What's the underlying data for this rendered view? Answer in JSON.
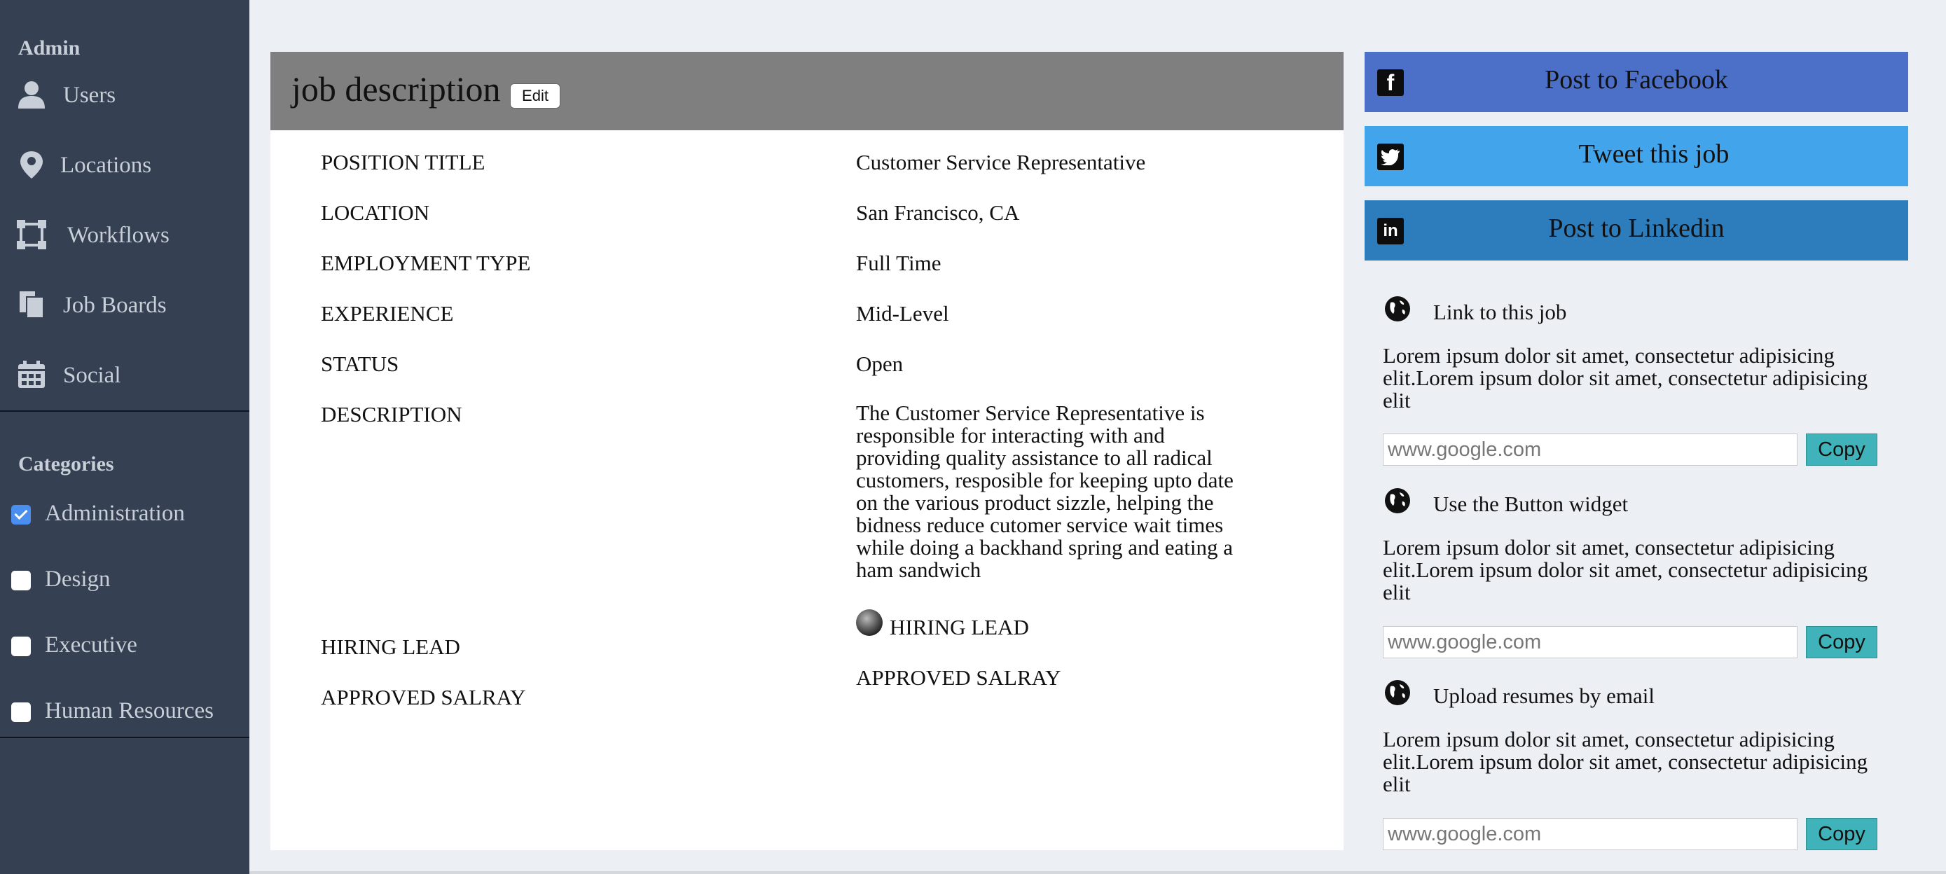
{
  "sidebar": {
    "admin_heading": "Admin",
    "items": [
      {
        "label": "Users",
        "icon": "user-icon"
      },
      {
        "label": "Locations",
        "icon": "map-pin-icon"
      },
      {
        "label": "Workflows",
        "icon": "workflow-icon"
      },
      {
        "label": "Job Boards",
        "icon": "clipboard-icon"
      },
      {
        "label": "Social",
        "icon": "calendar-icon"
      }
    ],
    "categories_heading": "Categories",
    "categories": [
      {
        "label": "Administration",
        "checked": true
      },
      {
        "label": "Design",
        "checked": false
      },
      {
        "label": "Executive",
        "checked": false
      },
      {
        "label": "Human Resources",
        "checked": false
      }
    ]
  },
  "job": {
    "title": "job description",
    "edit_label": "Edit",
    "fields": [
      {
        "label": "POSITION TITLE",
        "value": "Customer Service Representative"
      },
      {
        "label": "LOCATION",
        "value": "San Francisco, CA"
      },
      {
        "label": "EMPLOYMENT TYPE",
        "value": "Full Time"
      },
      {
        "label": "EXPERIENCE",
        "value": "Mid-Level"
      },
      {
        "label": "STATUS",
        "value": "Open"
      },
      {
        "label": "DESCRIPTION",
        "value": "The Customer Service Representative is responsible for interacting with and providing quality assistance to all radical customers, resposible for keeping upto date on the various product sizzle, helping the bidness reduce cutomer service wait times while doing a backhand spring and eating a ham sandwich"
      },
      {
        "label": "HIRING LEAD",
        "value": "HIRING LEAD"
      },
      {
        "label": "APPROVED SALRAY",
        "value": "APPROVED SALRAY"
      }
    ]
  },
  "social": {
    "facebook_label": "Post to Facebook",
    "twitter_label": "Tweet this job",
    "linkedin_label": "Post to Linkedin",
    "facebook_color": "#4c70c7",
    "twitter_color": "#42a4ea",
    "linkedin_color": "#2d7dbd"
  },
  "widgets": [
    {
      "title": "Link to this job",
      "text": "Lorem ipsum dolor sit amet, consectetur adipisicing elit.Lorem ipsum dolor sit amet, consectetur adipisicing elit",
      "input_value": "www.google.com",
      "copy_label": "Copy"
    },
    {
      "title": "Use the Button widget",
      "text": "Lorem ipsum dolor sit amet, consectetur adipisicing elit.Lorem ipsum dolor sit amet, consectetur adipisicing elit",
      "input_value": "www.google.com",
      "copy_label": "Copy"
    },
    {
      "title": "Upload resumes by email",
      "text": "Lorem ipsum dolor sit amet, consectetur adipisicing elit.Lorem ipsum dolor sit amet, consectetur adipisicing elit",
      "input_value": "www.google.com",
      "copy_label": "Copy"
    }
  ]
}
